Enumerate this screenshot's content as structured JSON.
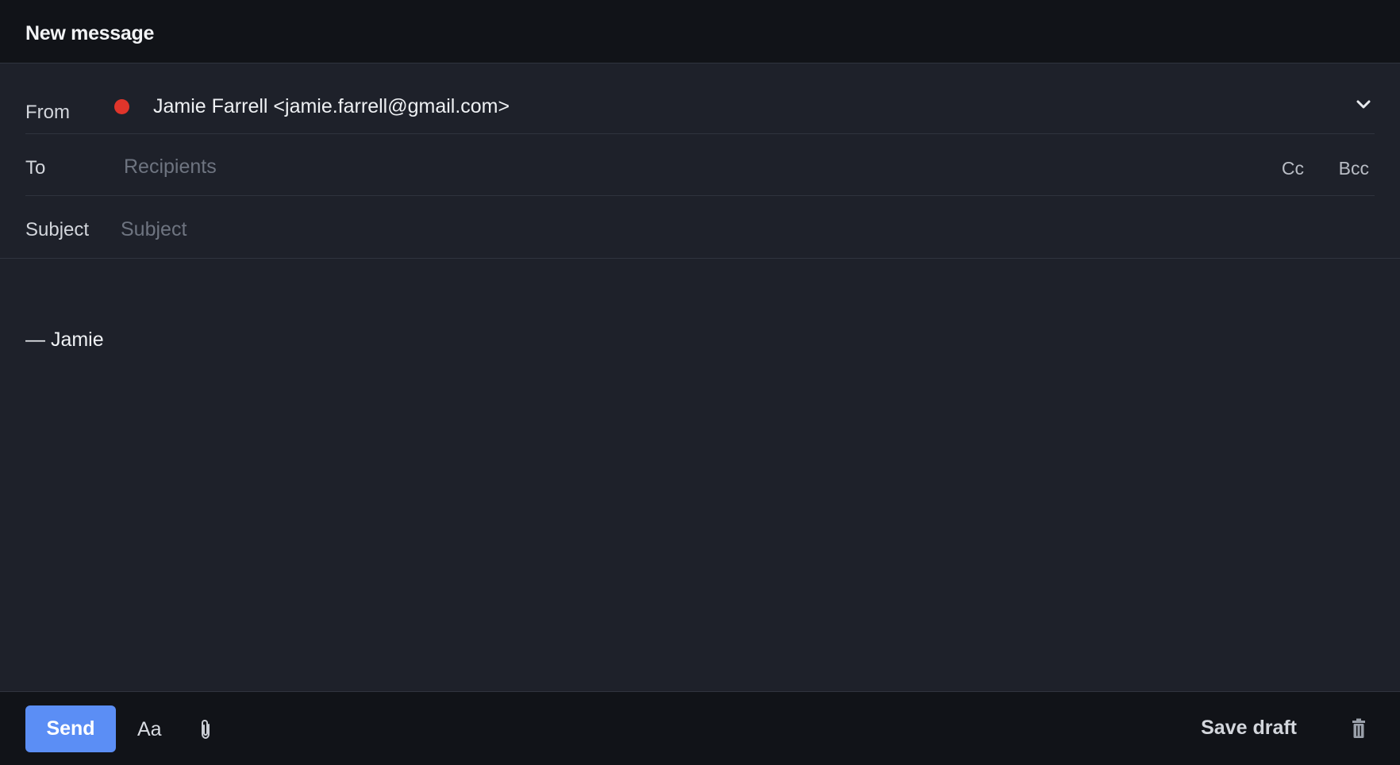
{
  "header": {
    "title": "New message"
  },
  "fields": {
    "from": {
      "label": "From",
      "value": "Jamie Farrell <jamie.farrell@gmail.com>",
      "status_color": "#e0352b"
    },
    "to": {
      "label": "To",
      "placeholder": "Recipients",
      "cc_label": "Cc",
      "bcc_label": "Bcc"
    },
    "subject": {
      "label": "Subject",
      "placeholder": "Subject"
    }
  },
  "body": {
    "signature": "— Jamie"
  },
  "footer": {
    "send_label": "Send",
    "format_label": "Aa",
    "save_draft_label": "Save draft",
    "send_color": "#5b8ef5",
    "icons": {
      "attach": "paperclip-icon",
      "discard": "trash-icon"
    }
  }
}
